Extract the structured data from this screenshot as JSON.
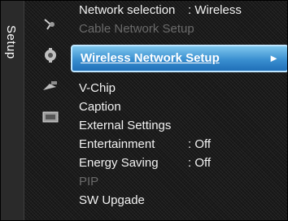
{
  "side_tab": {
    "label": "Setup"
  },
  "icons": [
    "antenna-icon",
    "setup-gear-icon",
    "satellite-icon",
    "input-panel-icon"
  ],
  "menu": {
    "items": [
      {
        "label": "Network selection",
        "value": ": Wireless",
        "state": "normal"
      },
      {
        "label": "Cable Network Setup",
        "value": "",
        "state": "disabled"
      },
      {
        "label": "Wireless Network Setup",
        "value": "",
        "state": "selected",
        "arrow": "►"
      },
      {
        "label": "V-Chip",
        "value": "",
        "state": "normal"
      },
      {
        "label": "Caption",
        "value": "",
        "state": "normal"
      },
      {
        "label": "External Settings",
        "value": "",
        "state": "normal"
      },
      {
        "label": "Entertainment",
        "value": ": Off",
        "state": "normal"
      },
      {
        "label": "Energy Saving",
        "value": ": Off",
        "state": "normal"
      },
      {
        "label": "PIP",
        "value": "",
        "state": "disabled"
      },
      {
        "label": "SW Upgade",
        "value": "",
        "state": "normal"
      }
    ]
  },
  "colors": {
    "highlight": "#3a8fd0",
    "background": "#1a1a1a",
    "text": "#f2f2f2",
    "disabled_text": "#6a6a6a"
  }
}
